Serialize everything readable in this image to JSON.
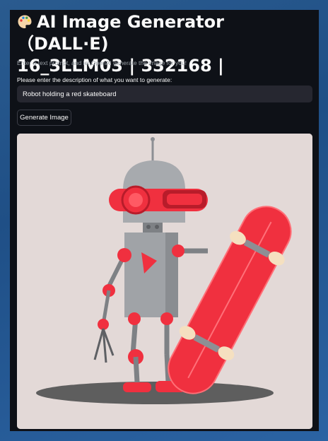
{
  "header": {
    "icon": "artist-palette-icon",
    "title_line1": "AI Image Generator（DALL·E)",
    "title_line2": "16_3LLM03 | 332168 |"
  },
  "caption": "Enter a text prompt, and let OpenAI generate the image for you!",
  "prompt": {
    "label": "Please enter the description of what you want to generate:",
    "value": "Robot holding a red skateboard"
  },
  "button": {
    "label": "Generate Image"
  },
  "image": {
    "subject": "robot-holding-red-skateboard-image"
  },
  "colors": {
    "app_background": "#0e1117",
    "input_background": "#262730",
    "accent_red": "#f0303f",
    "image_background": "#e3d9d7"
  }
}
